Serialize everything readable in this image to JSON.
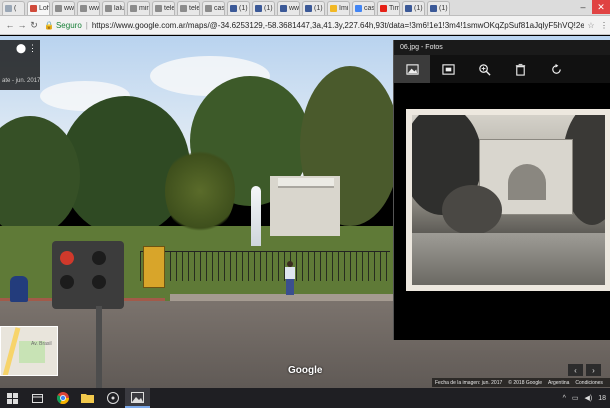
{
  "browser": {
    "tabs": [
      {
        "label": "(",
        "fav": "#9aa7b6"
      },
      {
        "label": "Loft",
        "fav": "#d04a3a"
      },
      {
        "label": "ww",
        "fav": "#8c8c8c"
      },
      {
        "label": "ww",
        "fav": "#8c8c8c"
      },
      {
        "label": "lalu",
        "fav": "#8c8c8c"
      },
      {
        "label": "mir",
        "fav": "#8c8c8c"
      },
      {
        "label": "tele",
        "fav": "#8c8c8c"
      },
      {
        "label": "tele",
        "fav": "#8c8c8c"
      },
      {
        "label": "cas",
        "fav": "#8c8c8c"
      },
      {
        "label": "(1)",
        "fav": "#3b5998"
      },
      {
        "label": "(1)",
        "fav": "#3b5998"
      },
      {
        "label": "ww",
        "fav": "#3b5998"
      },
      {
        "label": "(1)",
        "fav": "#3b5998"
      },
      {
        "label": "Imi",
        "fav": "#f2b824"
      },
      {
        "label": "cas",
        "fav": "#4285f4"
      },
      {
        "label": "Tim",
        "fav": "#e62117"
      },
      {
        "label": "(1)",
        "fav": "#3b5998"
      },
      {
        "label": "(1)",
        "fav": "#3b5998"
      }
    ],
    "secure_label": "Seguro",
    "url": "https://www.google.com.ar/maps/@-34.6253129,-58.3681447,3a,41.3y,227.64h,93t/data=!3m6!1e1!3m4!1smwOKqZpSuf81aJqlyF5hVQ!2e0!7i13312!8i6656"
  },
  "streetview": {
    "date": "ate - jun. 2017",
    "google_logo": "Google",
    "minimap_label": "Av. Brasil",
    "footer": {
      "image_date": "Fecha de la imagen: jun. 2017",
      "copyright": "© 2018 Google",
      "country": "Argentina",
      "terms": "Condiciones"
    }
  },
  "photos": {
    "title": "06.jpg - Fotos",
    "toolbar": [
      "image-icon",
      "slideshow-icon",
      "zoom-icon",
      "delete-icon",
      "rotate-icon"
    ]
  },
  "taskbar": {
    "clock": "18"
  }
}
